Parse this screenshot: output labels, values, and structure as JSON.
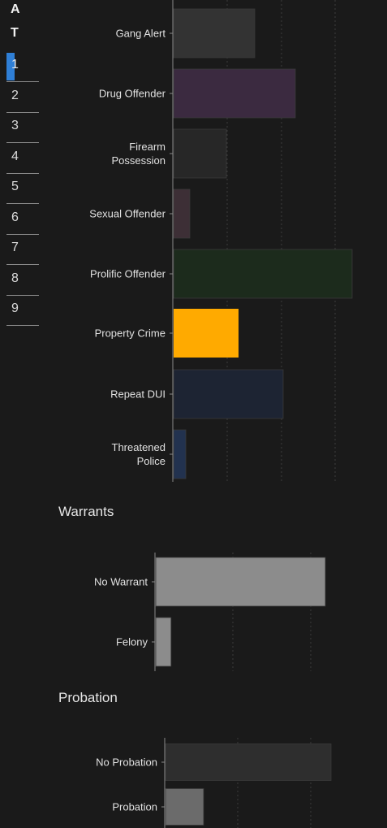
{
  "tabs": {
    "headers": [
      "A",
      "T"
    ],
    "items": [
      "1",
      "2",
      "3",
      "4",
      "5",
      "6",
      "7",
      "8",
      "9"
    ],
    "active_index": 0,
    "indicator_color": "#2f7fd6"
  },
  "sections": {
    "warrants_title": "Warrants",
    "probation_title": "Probation"
  },
  "chart_data": [
    {
      "type": "bar",
      "orientation": "horizontal",
      "title": "",
      "categories": [
        [
          "Gang Alert"
        ],
        [
          "Drug Offender"
        ],
        [
          "Firearm",
          "Possession"
        ],
        [
          "Sexual Offender"
        ],
        [
          "Prolific Offender"
        ],
        [
          "Property Crime"
        ],
        [
          "Repeat DUI"
        ],
        [
          "Threatened",
          "Police"
        ]
      ],
      "values": [
        20,
        30,
        13,
        4,
        44,
        16,
        27,
        3
      ],
      "colors": [
        "#333333",
        "#3b2a40",
        "#272727",
        "#3d2f36",
        "#1c2b1c",
        "#ffaa00",
        "#1d2433",
        "#22324f"
      ],
      "xlim": [
        0,
        45
      ],
      "grid": true
    },
    {
      "type": "bar",
      "orientation": "horizontal",
      "title": "Warrants",
      "categories": [
        [
          "No Warrant"
        ],
        [
          "Felony"
        ]
      ],
      "values": [
        100,
        9
      ],
      "colors": [
        "#8c8c8c",
        "#8c8c8c"
      ],
      "xlim": [
        0,
        135
      ],
      "grid": true
    },
    {
      "type": "bar",
      "orientation": "horizontal",
      "title": "Probation",
      "categories": [
        [
          "No Probation"
        ],
        [
          "Probation"
        ]
      ],
      "values": [
        100,
        23
      ],
      "colors": [
        "#2e2e2e",
        "#6b6b6b"
      ],
      "xlim": [
        0,
        135
      ],
      "grid": true
    }
  ]
}
